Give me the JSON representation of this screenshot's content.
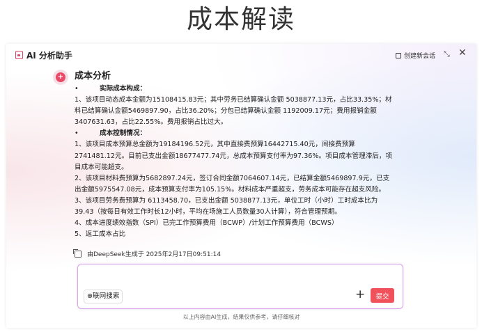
{
  "page_title": "成本解读",
  "header": {
    "app_name": "AI 分析助手",
    "new_chat_label": "创建新会话",
    "collapse_icon": "collapse-icon",
    "close_icon": "close-icon"
  },
  "message": {
    "title": "成本分析",
    "sections": [
      {
        "bullet": "实际成本构成：",
        "lines": [
          "1、该项目动态成本金额为15108415.83元；其中劳务已结算确认金额 5038877.13元，占比33.35%；材",
          "料已结算确认金额5469897.90，占比36.20%；分包已结算确认金额 1192009.17元；费用报销金额",
          "3407631.63，占比22.55%。费用报销占比过大。"
        ]
      },
      {
        "bullet": "成本控制情况：",
        "lines": [
          "1、该项目成本预算总金额为19184196.52元，其中直接费预算16442715.40元，间接费预算",
          "2741481.12元。目前已支出金额18677477.74元，总成本预算支付率为97.36%。项目成本管理滞后，项",
          "目成本可能超支。",
          "2、该项目材料费预算为5682897.24元，签订合同金额7064607.14元，已结算金额5469897.9元，已支",
          "出金额5975547.08元，成本预算支付率为105.15%。材料成本严重超支，劳务成本可能存在超支风险。",
          "3、该项目劳务费预算为 6113458.70，已支出金额 5038877.13元，单位工时（小时）工时成本比为",
          "39.43（按每日有效工作时长12小时，平均在场施工人员数量30人计算），符合管理预期。",
          "4、成本进度绩效指数（SPI）已完工作预算费用（BCWP）/计划工作预算费用（BCWS）",
          "5、返工成本占比"
        ]
      }
    ],
    "generated_by": "由DeepSeek生成于 2025年2月17日09:51:14"
  },
  "input": {
    "web_search_label": "⊕联网搜索",
    "submit_label": "提交"
  },
  "footer_note": "以上内容由AI生成，结果仅供参考，请仔细核对",
  "colors": {
    "accent": "#e94a67",
    "submit": "#f0515a",
    "input_border": "#d7a6e6"
  }
}
